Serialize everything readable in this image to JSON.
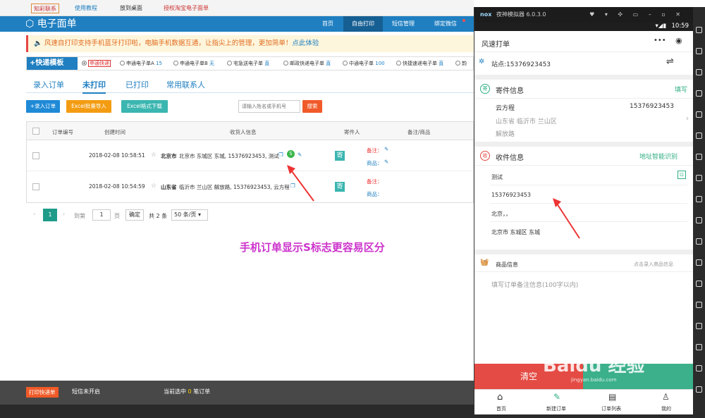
{
  "browser_tabs": [
    "知彩联系",
    "使用教程",
    "放到桌面",
    "授权淘宝电子面单"
  ],
  "app": {
    "title": "电子面单",
    "nav": [
      "首页",
      "自由打印",
      "短信管理",
      "绑定微信"
    ],
    "notice_prefix": "风速",
    "notice": "自打印支持手机蓝牙打印啦，电脑手机数据互通，让指尖上的管理，更加简单！",
    "notice_link": "点此体验",
    "template_label": "+快递模板",
    "templates": [
      {
        "label": "申通快递",
        "selected": true
      },
      {
        "label": "申通电子单A",
        "count": "15"
      },
      {
        "label": "申通电子单B",
        "tag": "无"
      },
      {
        "label": "宅急送电子单",
        "tag": "直"
      },
      {
        "label": "邮政快递电子单",
        "tag": "直"
      },
      {
        "label": "中通电子单",
        "count": "100"
      },
      {
        "label": "快捷速递电子单",
        "tag": "直"
      },
      {
        "label": "韵"
      }
    ],
    "tabs": [
      "录入订单",
      "未打印",
      "已打印",
      "常用联系人"
    ],
    "buttons": {
      "entry": "+录入订单",
      "excel_import": "Excel批量导入",
      "excel_download": "Excel格式下载",
      "search": "搜索"
    },
    "search_placeholder": "请输入姓名或手机号",
    "table": {
      "headers": [
        "订单编号",
        "创建时间",
        "收货人信息",
        "寄件人",
        "备注/商品"
      ],
      "rows": [
        {
          "time": "2018-02-08 10:58:51",
          "recv_city": "北京市",
          "recv_info": "北京市 东城区 东城, 15376923453, 测试",
          "sender_icon": "寄",
          "note_label": "备注：",
          "goods_label": "商品："
        },
        {
          "time": "2018-02-08 10:54:59",
          "recv_city": "山东省",
          "recv_info": "临沂市 兰山区 解放路, 15376923453, 云方程",
          "sender_icon": "寄",
          "note_label": "备注：",
          "goods_label": "商品："
        }
      ]
    },
    "pager": {
      "page": "1",
      "goto_label": "到第",
      "page_input": "1",
      "page_suffix": "页",
      "confirm": "确定",
      "total": "共 2 条",
      "per_page": "50 条/页"
    },
    "caption": "手机订单显示S标志更容易区分",
    "bottom": {
      "quick_order": "打印快递单",
      "sms_status": "短信未开启",
      "selected_prefix": "当前选中",
      "selected_count": "0",
      "selected_suffix": "笔订单"
    }
  },
  "phone": {
    "emulator_title": "夜神模拟器 6.0.3.0",
    "emulator_logo": "nox",
    "time": "10:59",
    "header_title": "风速打单",
    "station": "站点:15376923453",
    "sender": {
      "title": "寄件信息",
      "action": "填写",
      "name": "云方程",
      "phone": "15376923453",
      "region": "山东省 临沂市 兰山区",
      "address": "解放路"
    },
    "receiver": {
      "title": "收件信息",
      "action": "地址智能识别",
      "name": "测试",
      "phone": "15376923453",
      "province": "北京，，",
      "district": "北京市 东城区 东城"
    },
    "goods": {
      "title": "商品信息",
      "hint": "点击录入商品信息",
      "remark_placeholder": "填写订单备注信息(100字以内)"
    },
    "clear": "清空",
    "tabbar": [
      "首页",
      "新建订单",
      "订单列表",
      "我的"
    ]
  },
  "watermark": "Baidu 经验",
  "watermark_sub": "jingyan.baidu.com",
  "colors": {
    "brand": "#1f7fc1",
    "accent": "#e64545",
    "green": "#3bb08a",
    "caption": "#cc33cc"
  }
}
